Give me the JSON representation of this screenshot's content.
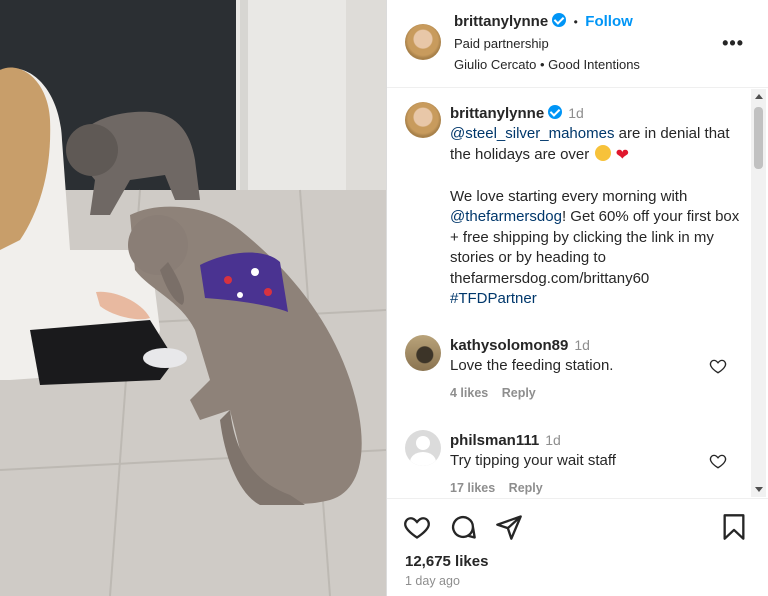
{
  "header": {
    "username": "brittanylynne",
    "dot": "•",
    "follow_label": "Follow",
    "subtitle": "Paid partnership",
    "partners": "Giulio Cercato • Good Intentions",
    "more_label": "•••"
  },
  "caption": {
    "username": "brittanylynne",
    "time": "1d",
    "mention1": "@steel_silver_mahomes",
    "text1": " are in denial that the holidays are over ",
    "heart": "❤",
    "text2a": "We love starting every morning with ",
    "mention2": "@thefarmersdog",
    "text2b": "! Get 60% off your first box + free shipping by clicking the link in my stories or by heading to thefarmersdog.com/brittany60 ",
    "hashtag": "#TFDPartner"
  },
  "comments": [
    {
      "username": "kathysolomon89",
      "time": "1d",
      "text": "Love the feeding station.",
      "likes": "4 likes",
      "reply_label": "Reply"
    },
    {
      "username": "philsman111",
      "time": "1d",
      "text": "Try tipping your wait staff",
      "likes": "17 likes",
      "reply_label": "Reply"
    }
  ],
  "footer": {
    "likes_count": "12,675 likes",
    "posted_ago": "1 day ago"
  },
  "colors": {
    "accent": "#0095f6",
    "link": "#00376b",
    "muted": "#8e8e8e"
  },
  "icons": [
    "verified-badge-icon",
    "more-options-icon",
    "heart-icon",
    "comment-icon",
    "share-icon",
    "bookmark-icon"
  ]
}
